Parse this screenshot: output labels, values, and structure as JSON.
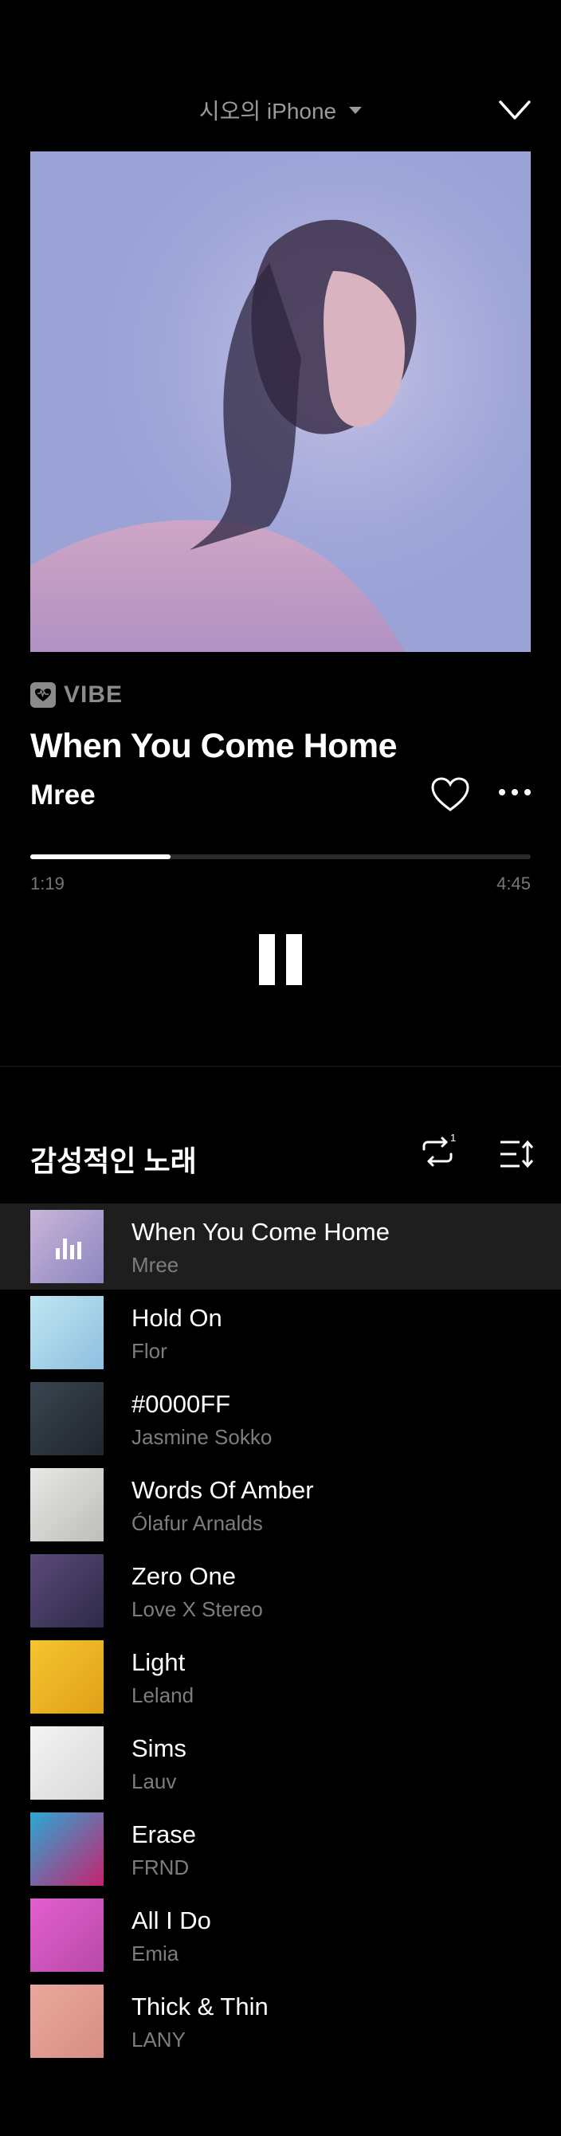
{
  "device": {
    "name": "시오의 iPhone"
  },
  "player": {
    "service": "VIBE",
    "title": "When You Come Home",
    "artist": "Mree",
    "elapsed": "1:19",
    "duration": "4:45",
    "progress": 0.28
  },
  "playlist": {
    "title": "감성적인 노래",
    "repeat_badge": "1",
    "tracks": [
      {
        "name": "When You Come Home",
        "artist": "Mree",
        "playing": true,
        "thumb": [
          "#c9b5d9",
          "#8d86bf"
        ]
      },
      {
        "name": "Hold On",
        "artist": "Flor",
        "playing": false,
        "thumb": [
          "#bfe6f2",
          "#8fbfe0"
        ]
      },
      {
        "name": "#0000FF",
        "artist": "Jasmine Sokko",
        "playing": false,
        "thumb": [
          "#3b4450",
          "#1f262d"
        ]
      },
      {
        "name": "Words Of Amber",
        "artist": "Ólafur Arnalds",
        "playing": false,
        "thumb": [
          "#e8e8e6",
          "#bdbdb9"
        ]
      },
      {
        "name": "Zero One",
        "artist": "Love X Stereo",
        "playing": false,
        "thumb": [
          "#5a4a7a",
          "#2e2a48"
        ]
      },
      {
        "name": "Light",
        "artist": "Leland",
        "playing": false,
        "thumb": [
          "#f5c430",
          "#e0a019"
        ]
      },
      {
        "name": "Sims",
        "artist": "Lauv",
        "playing": false,
        "thumb": [
          "#f3f3f3",
          "#d9d9d9"
        ]
      },
      {
        "name": "Erase",
        "artist": "FRND",
        "playing": false,
        "thumb": [
          "#2ba9d6",
          "#c5226e"
        ]
      },
      {
        "name": "All I Do",
        "artist": "Emia",
        "playing": false,
        "thumb": [
          "#e25fcf",
          "#b84aa8"
        ]
      },
      {
        "name": "Thick & Thin",
        "artist": "LANY",
        "playing": false,
        "thumb": [
          "#e9a89c",
          "#d88e84"
        ]
      }
    ]
  },
  "icons": {
    "collapse": "chevron-down-icon",
    "like": "heart-icon",
    "more": "more-dots-icon",
    "pause": "pause-icon",
    "repeat": "repeat-one-icon",
    "sort": "sort-icon"
  }
}
